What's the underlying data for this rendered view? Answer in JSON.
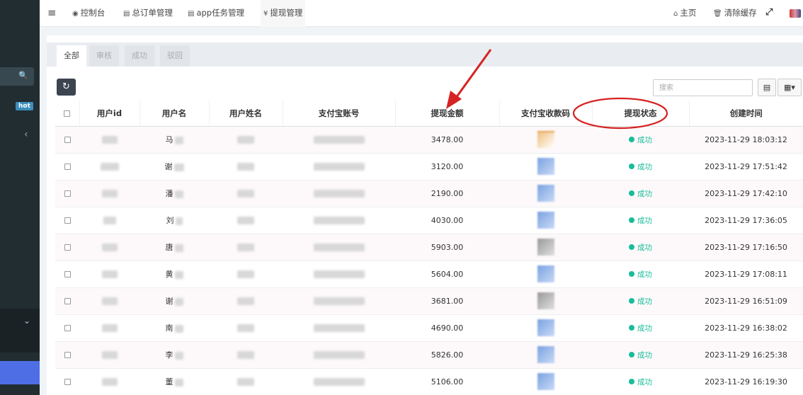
{
  "sidebar": {
    "hot_badge": "hot"
  },
  "topbar": {
    "menu_icon": "≡",
    "tabs": [
      {
        "icon": "dashboard-icon",
        "label": "控制台"
      },
      {
        "icon": "file-icon",
        "label": "总订单管理"
      },
      {
        "icon": "list-icon",
        "label": "app任务管理"
      },
      {
        "icon": "yen-icon",
        "label": "提现管理"
      }
    ],
    "home": "主页",
    "clear_cache": "清除缓存"
  },
  "filter_tabs": [
    "全部",
    "审核",
    "成功",
    "驳回"
  ],
  "toolbar": {
    "search_placeholder": "搜索"
  },
  "table": {
    "headers": [
      "用户id",
      "用户名",
      "用户姓名",
      "支付宝账号",
      "提现金额",
      "支付宝收款码",
      "提现状态",
      "创建时间"
    ],
    "rows": [
      {
        "name": "马",
        "amount": "3478.00",
        "status": "成功",
        "time": "2023-11-29 18:03:12",
        "qr": "o"
      },
      {
        "name": "谢",
        "amount": "3120.00",
        "status": "成功",
        "time": "2023-11-29 17:51:42",
        "qr": "b"
      },
      {
        "name": "潘",
        "amount": "2190.00",
        "status": "成功",
        "time": "2023-11-29 17:42:10",
        "qr": "b"
      },
      {
        "name": "刘",
        "amount": "4030.00",
        "status": "成功",
        "time": "2023-11-29 17:36:05",
        "qr": "b"
      },
      {
        "name": "唐",
        "amount": "5903.00",
        "status": "成功",
        "time": "2023-11-29 17:16:50",
        "qr": "g"
      },
      {
        "name": "黄",
        "amount": "5604.00",
        "status": "成功",
        "time": "2023-11-29 17:08:11",
        "qr": "b"
      },
      {
        "name": "谢",
        "amount": "3681.00",
        "status": "成功",
        "time": "2023-11-29 16:51:09",
        "qr": "g"
      },
      {
        "name": "南",
        "amount": "4690.00",
        "status": "成功",
        "time": "2023-11-29 16:38:02",
        "qr": "b"
      },
      {
        "name": "李",
        "amount": "5826.00",
        "status": "成功",
        "time": "2023-11-29 16:25:38",
        "qr": "b"
      },
      {
        "name": "董",
        "amount": "5106.00",
        "status": "成功",
        "time": "2023-11-29 16:19:30",
        "qr": "b"
      }
    ]
  },
  "annotation_color": "#d62222"
}
